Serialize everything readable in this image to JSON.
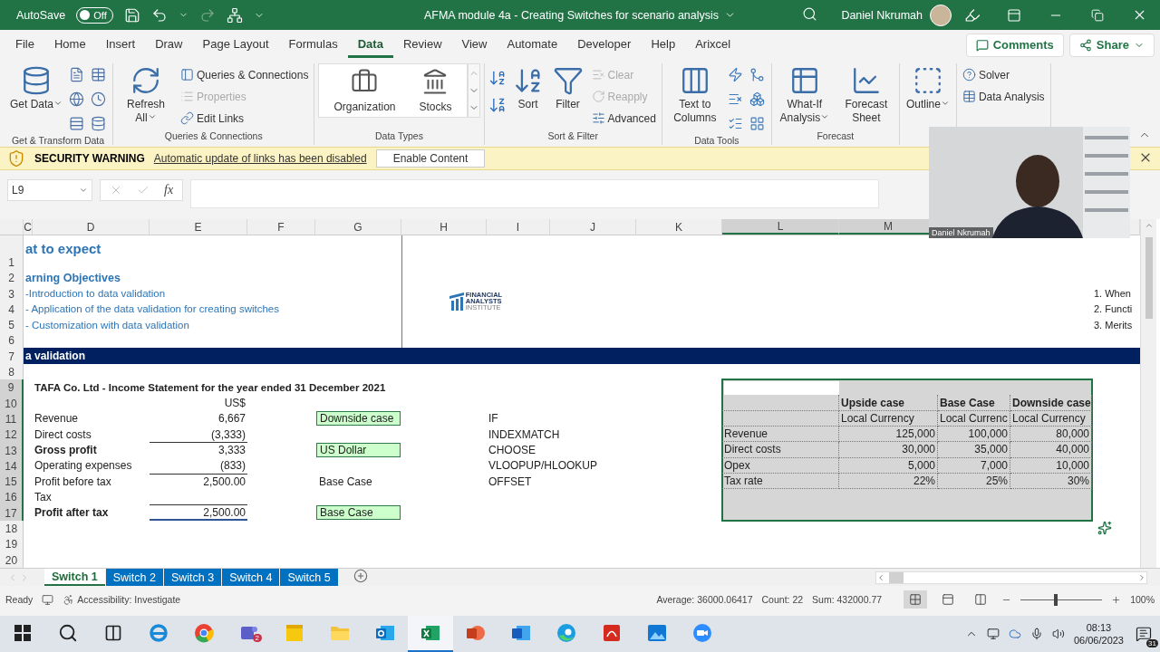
{
  "title_bar": {
    "autosave": {
      "label": "AutoSave",
      "on": false,
      "state": "Off"
    },
    "title": "AFMA module 4a - Creating Switches for scenario analysis",
    "user": "Daniel Nkrumah"
  },
  "menu_tabs": [
    {
      "label": "File",
      "selected": false
    },
    {
      "label": "Home",
      "selected": false
    },
    {
      "label": "Insert",
      "selected": false
    },
    {
      "label": "Draw",
      "selected": false
    },
    {
      "label": "Page Layout",
      "selected": false
    },
    {
      "label": "Formulas",
      "selected": false
    },
    {
      "label": "Data",
      "selected": true
    },
    {
      "label": "Review",
      "selected": false
    },
    {
      "label": "View",
      "selected": false
    },
    {
      "label": "Automate",
      "selected": false
    },
    {
      "label": "Developer",
      "selected": false
    },
    {
      "label": "Help",
      "selected": false
    },
    {
      "label": "Arixcel",
      "selected": false
    }
  ],
  "comments_button": "Comments",
  "share_button": "Share",
  "ribbon": [
    {
      "label": "Get & Transform Data",
      "items": [
        {
          "kind": "large",
          "label": "Get Data",
          "dropdown": true,
          "disabled": false
        }
      ]
    },
    {
      "label": "Queries & Connections",
      "items": [
        {
          "kind": "large",
          "label": "Refresh All",
          "dropdown": true,
          "disabled": false
        },
        {
          "kind": "small",
          "label": "Queries & Connections",
          "dropdown": false,
          "disabled": false
        },
        {
          "kind": "small",
          "label": "Properties",
          "dropdown": false,
          "disabled": true
        },
        {
          "kind": "small",
          "label": "Edit Links",
          "dropdown": false,
          "disabled": false
        }
      ]
    },
    {
      "label": "Data Types",
      "items": [
        {
          "kind": "gallery",
          "label": "Organization",
          "dropdown": false,
          "disabled": false
        },
        {
          "kind": "gallery",
          "label": "Stocks",
          "dropdown": false,
          "disabled": false
        }
      ]
    },
    {
      "label": "Sort & Filter",
      "items": [
        {
          "kind": "large",
          "label": "Sort",
          "dropdown": false,
          "disabled": false
        },
        {
          "kind": "large",
          "label": "Filter",
          "dropdown": false,
          "disabled": false
        },
        {
          "kind": "small",
          "label": "Clear",
          "dropdown": false,
          "disabled": true
        },
        {
          "kind": "small",
          "label": "Reapply",
          "dropdown": false,
          "disabled": true
        },
        {
          "kind": "small",
          "label": "Advanced",
          "dropdown": false,
          "disabled": false
        }
      ]
    },
    {
      "label": "Data Tools",
      "items": [
        {
          "kind": "large",
          "label": "Text to Columns",
          "dropdown": false,
          "disabled": false
        }
      ]
    },
    {
      "label": "Forecast",
      "items": [
        {
          "kind": "large",
          "label": "What-If Analysis",
          "dropdown": true,
          "disabled": false
        },
        {
          "kind": "large",
          "label": "Forecast Sheet",
          "dropdown": false,
          "disabled": false
        }
      ]
    },
    {
      "items": [
        {
          "kind": "large",
          "label": "Outline",
          "dropdown": true,
          "disabled": false
        }
      ]
    },
    {
      "items": [
        {
          "kind": "small",
          "label": "Solver",
          "dropdown": false,
          "disabled": false
        },
        {
          "kind": "small",
          "label": "Data Analysis",
          "dropdown": false,
          "disabled": false
        }
      ]
    }
  ],
  "security_bar": {
    "title": "SECURITY WARNING",
    "message": "Automatic update of links has been disabled",
    "button": "Enable Content"
  },
  "formula_bar": {
    "name_box": "L9",
    "fx": "fx"
  },
  "webcam": {
    "kind": "picture",
    "name": "Daniel Nkrumah"
  },
  "column_headers": [
    "C",
    "D",
    "E",
    "F",
    "G",
    "H",
    "I",
    "J",
    "K",
    "L",
    "M"
  ],
  "row_numbers": [
    "1",
    "2",
    "3",
    "4",
    "5",
    "6",
    "7",
    "8",
    "9",
    "10",
    "11",
    "12",
    "13",
    "14",
    "15",
    "16",
    "17",
    "18",
    "19",
    "20"
  ],
  "intro": {
    "heading": "at to expect",
    "objectives_title": "arning Objectives",
    "objectives": [
      "-Introduction to data validation",
      "- Application of the data validation for creating switches",
      "- Customization with data validation"
    ]
  },
  "logo": {
    "lines": [
      "FINANCIAL",
      "ANALYSTS",
      "INSTITUTE"
    ]
  },
  "agenda": [
    "1. When",
    "2. Functi",
    "3. Merits"
  ],
  "band": {
    "title": "a validation"
  },
  "income_statement": {
    "title": "TAFA Co. Ltd - Income Statement for the year ended 31 December 2021",
    "currency": "US$",
    "lines": [
      {
        "label": "Revenue",
        "value": "6,667",
        "bold": false,
        "rule_above": false,
        "rule_below": false
      },
      {
        "label": "Direct costs",
        "value": "(3,333)",
        "bold": false,
        "rule_above": false,
        "rule_below": false
      },
      {
        "label": "Gross profit",
        "value": "3,333",
        "bold": true,
        "rule_above": true,
        "rule_below": false
      },
      {
        "label": "Operating expenses",
        "value": "(833)",
        "bold": false,
        "rule_above": false,
        "rule_below": false
      },
      {
        "label": "Profit before tax",
        "value": "2,500.00",
        "bold": false,
        "rule_above": true,
        "rule_below": false
      },
      {
        "label": "Tax",
        "bold": false
      },
      {
        "label": "Profit after tax",
        "value": "2,500.00",
        "bold": true,
        "rule_above": true,
        "rule_below": true
      }
    ]
  },
  "switches": [
    {
      "kind": "dropdown",
      "value": "Downside case"
    },
    {
      "kind": "dropdown",
      "value": "US Dollar"
    },
    {
      "kind": "text",
      "value": "Base Case"
    },
    {
      "kind": "dropdown",
      "value": "Base Case"
    }
  ],
  "functions": [
    "IF",
    "INDEXMATCH",
    "CHOOSE",
    "VLOOPUP/HLOOKUP",
    "OFFSET"
  ],
  "scenario_table": {
    "selected": true,
    "columns": [
      {
        "name": "Upside case",
        "currency": "Local Currency"
      },
      {
        "name": "Base Case",
        "currency": "Local Currenc"
      },
      {
        "name": "Downside case",
        "currency": "Local Currency"
      }
    ],
    "rows": [
      {
        "label": "Revenue",
        "values": [
          "125,000",
          "100,000",
          "80,000"
        ]
      },
      {
        "label": "Direct costs",
        "values": [
          "30,000",
          "35,000",
          "40,000"
        ]
      },
      {
        "label": "Opex",
        "values": [
          "5,000",
          "7,000",
          "10,000"
        ]
      },
      {
        "label": "Tax rate",
        "values": [
          "22%",
          "25%",
          "30%"
        ]
      }
    ]
  },
  "sheet_tabs": [
    {
      "label": "Switch 1",
      "selected": true
    },
    {
      "label": "Switch 2",
      "selected": false
    },
    {
      "label": "Switch 3",
      "selected": false
    },
    {
      "label": "Switch 4",
      "selected": false
    },
    {
      "label": "Switch 5",
      "selected": false
    }
  ],
  "status_bar": {
    "mode": "Ready",
    "accessibility": "Accessibility: Investigate",
    "average": "Average: 36000.06417",
    "count": "Count: 22",
    "sum": "Sum: 432000.77",
    "views": [
      {
        "kind": "normal",
        "selected": true
      },
      {
        "kind": "layout",
        "selected": false
      },
      {
        "kind": "break",
        "selected": false
      }
    ],
    "zoom": {
      "level": 0.43,
      "label": "100%"
    }
  },
  "taskbar": {
    "apps": [
      {
        "kind": "start",
        "selected": false
      },
      {
        "kind": "search",
        "selected": false
      },
      {
        "kind": "taskview",
        "selected": false
      },
      {
        "kind": "ie",
        "selected": false
      },
      {
        "kind": "chrome",
        "selected": false
      },
      {
        "kind": "teams",
        "selected": false,
        "badge": "2"
      },
      {
        "kind": "notes",
        "selected": false
      },
      {
        "kind": "explorer",
        "selected": false
      },
      {
        "kind": "outlook",
        "selected": false
      },
      {
        "kind": "excel",
        "selected": true
      },
      {
        "kind": "powerpoint",
        "selected": false
      },
      {
        "kind": "word",
        "selected": false
      },
      {
        "kind": "edge",
        "selected": false
      },
      {
        "kind": "acrobat",
        "selected": false
      },
      {
        "kind": "photos",
        "selected": false
      },
      {
        "kind": "zoom",
        "selected": false
      }
    ],
    "time": "08:13",
    "date": "06/06/2023",
    "notifications": "31"
  }
}
